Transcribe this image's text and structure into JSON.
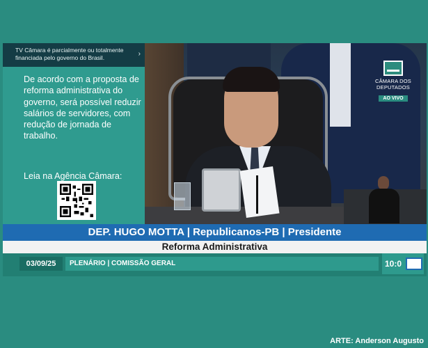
{
  "panel": {
    "notice": "TV Câmara é parcialmente ou totalmente financiada pelo governo do Brasil.",
    "text": "De acordo com a proposta de reforma administrativa do governo, será possível reduzir salários de servidores, com redução de jornada de trabalho.",
    "link_label": "Leia na Agência Câmara:"
  },
  "logo": {
    "line1": "CÂMARA DOS",
    "line2": "DEPUTADOS",
    "live_label": "AO VIVO"
  },
  "lower_third": {
    "name_line": "DEP. HUGO MOTTA | Republicanos-PB | Presidente",
    "subject": "Reforma Administrativa",
    "date": "03/09/25",
    "location": "PLENÁRIO | COMISSÃO GERAL",
    "clock": "10:0"
  },
  "credit": "ARTE: Anderson Augusto",
  "icons": {
    "notice_chevron": "chevron-right-icon",
    "qr": "qr-code-icon",
    "logo": "camara-logo-icon"
  },
  "colors": {
    "background": "#2a8c80",
    "panel": "#2f9b8f",
    "name_bar": "#1f6bb2",
    "footer": "#227f73"
  }
}
